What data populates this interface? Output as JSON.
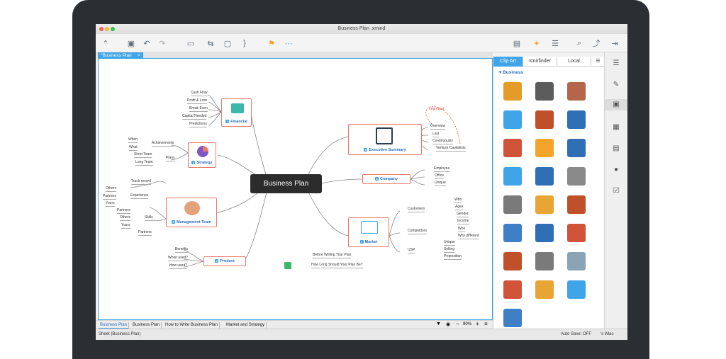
{
  "window_title": "Business Plan .xmind",
  "doc_tab": "*Business Plan",
  "toolbar": {
    "icons": [
      "logo-icon",
      "save-icon",
      "undo-icon",
      "redo-icon",
      "structure-icon",
      "relationship-icon",
      "boundary-icon",
      "summary-icon",
      "marker-icon",
      "more-icon",
      "presentation-icon",
      "brainstorm-icon",
      "outline-icon",
      "search-icon",
      "share-icon",
      "export-icon"
    ]
  },
  "central_topic": "Business Plan",
  "branches": {
    "financial": {
      "label": "Financial",
      "num": "1",
      "leaves": [
        "Cash Flow",
        "Profit & Loss",
        "Break Even",
        "Capital Needed",
        "Predictions"
      ]
    },
    "strategy": {
      "label": "Strategy",
      "num": "2",
      "sub": [
        "Achievements",
        "Plans"
      ],
      "achievements": [
        "When",
        "What"
      ],
      "plans": [
        "Short Team",
        "Long Team"
      ]
    },
    "management": {
      "label": "Management Team",
      "num": "3",
      "sub": [
        "Experience",
        "Skills"
      ],
      "top": "Track record",
      "experience": [
        "Others",
        "Partners",
        "Yours"
      ],
      "skills": [
        "Partners",
        "Others",
        "Yours"
      ],
      "bottom": "Partners"
    },
    "product": {
      "label": "Product",
      "num": "4",
      "leaves": [
        "Benefits",
        "When used?",
        "How used?"
      ]
    },
    "executive": {
      "label": "Executive Summary",
      "num": "5",
      "note": "Important",
      "leaves": [
        "Overview",
        "Last",
        "Continuously",
        "Venture Capitalists"
      ]
    },
    "company": {
      "label": "Company",
      "num": "6",
      "leaves": [
        "Employee",
        "Office",
        "Unique"
      ]
    },
    "market": {
      "label": "Market",
      "num": "7",
      "sub": [
        "Customers",
        "Competitors",
        "USP"
      ],
      "customers": [
        "Who",
        "Ages",
        "Gender",
        "Income"
      ],
      "competitors": [
        "Who",
        "Why different"
      ],
      "usp": [
        "Unique",
        "Selling",
        "Proposition"
      ]
    },
    "floating": [
      "Before Writing Your Plan",
      "How Long Should Your Plan Be?"
    ]
  },
  "sheets": [
    "Business Plan",
    "Business Plan",
    "How to Write Business Plan",
    "Market and Strategy"
  ],
  "zoom": "90%",
  "status_left": "Sheet (Business Plan)",
  "status_autosave": "Auto Save: OFF",
  "status_user": "'s iMac",
  "panel": {
    "tabs": [
      "Clip Art",
      "Iconfinder",
      "Local"
    ],
    "section": "Business",
    "clips": [
      {
        "name": "scales-clip",
        "color": "#e49b2a"
      },
      {
        "name": "briefcase-clip",
        "color": "#5c5c5c"
      },
      {
        "name": "calculator-clip",
        "color": "#b5664a"
      },
      {
        "name": "chat-clip",
        "color": "#3fa4e8"
      },
      {
        "name": "coffee-clip",
        "color": "#c0502a"
      },
      {
        "name": "contacts-clip",
        "color": "#2f6fb5"
      },
      {
        "name": "support-clip",
        "color": "#d0533a"
      },
      {
        "name": "mail-clip",
        "color": "#f2a52a"
      },
      {
        "name": "search-doc-clip",
        "color": "#2f6fb5"
      },
      {
        "name": "folder-clip",
        "color": "#3fa4e8"
      },
      {
        "name": "globe-clip",
        "color": "#2f6fb5"
      },
      {
        "name": "printer-doc-clip",
        "color": "#8a8a8a"
      },
      {
        "name": "newspaper-clip",
        "color": "#7a7a7a"
      },
      {
        "name": "pencil-clip",
        "color": "#e9a534"
      },
      {
        "name": "presentation-clip",
        "color": "#c0502a"
      },
      {
        "name": "printer-clip",
        "color": "#3f7fc5"
      },
      {
        "name": "magnifier-clip",
        "color": "#2f6fb5"
      },
      {
        "name": "target-clip",
        "color": "#d0533a"
      },
      {
        "name": "team-clip",
        "color": "#c0502a"
      },
      {
        "name": "clock-clip",
        "color": "#7a7a7a"
      },
      {
        "name": "certificate-clip",
        "color": "#8aa3b5"
      },
      {
        "name": "chart-up-clip",
        "color": "#d0533a"
      },
      {
        "name": "coin-clip",
        "color": "#e9a534"
      },
      {
        "name": "microphone-clip",
        "color": "#3fa4e8"
      },
      {
        "name": "window-clip",
        "color": "#3f7fc5"
      }
    ]
  },
  "sidebar_icons": [
    "outline-icon",
    "format-icon",
    "image-icon",
    "markers-icon",
    "notes-icon",
    "comments-icon",
    "task-icon"
  ]
}
